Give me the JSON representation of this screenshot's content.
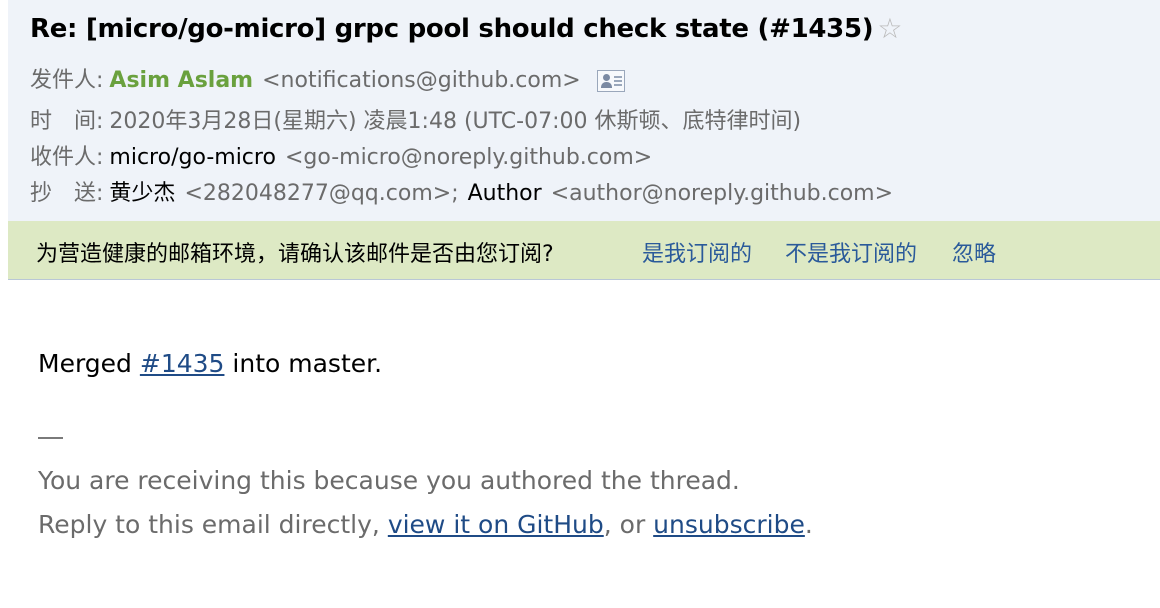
{
  "subject": "Re: [micro/go-micro] grpc pool should check state (#1435)",
  "star_icon": "☆",
  "header": {
    "from_label": "发件人:",
    "from_name": "Asim Aslam",
    "from_email": "<notifications@github.com>",
    "time_label": "时　间:",
    "time_value": "2020年3月28日(星期六) 凌晨1:48 (UTC-07:00 休斯顿、底特律时间)",
    "to_label": "收件人:",
    "to_name": "micro/go-micro",
    "to_email": "<go-micro@noreply.github.com>",
    "cc_label": "抄　送:",
    "cc1_name": "黄少杰",
    "cc1_email": "<282048277@qq.com>;",
    "cc2_name": "Author",
    "cc2_email": "<author@noreply.github.com>"
  },
  "notice": {
    "text": "为营造健康的邮箱环境，请确认该邮件是否由您订阅?",
    "yes_label": "是我订阅的",
    "no_label": "不是我订阅的",
    "ignore_label": "忽略"
  },
  "body": {
    "merged_prefix": "Merged",
    "merged_link": "#1435",
    "merged_suffix": "into master.",
    "dash": "—",
    "footer_line1": "You are receiving this because you authored the thread.",
    "footer_line2_prefix": "Reply to this email directly,",
    "footer_link_github": "view it on GitHub",
    "footer_line2_mid": ", or",
    "footer_link_unsubscribe": "unsubscribe",
    "footer_line2_suffix": "."
  },
  "colors": {
    "header_bg": "#eff3f9",
    "notice_bg": "#dde9c4",
    "sender_green": "#6aa13e",
    "link_blue": "#1f4b86"
  }
}
